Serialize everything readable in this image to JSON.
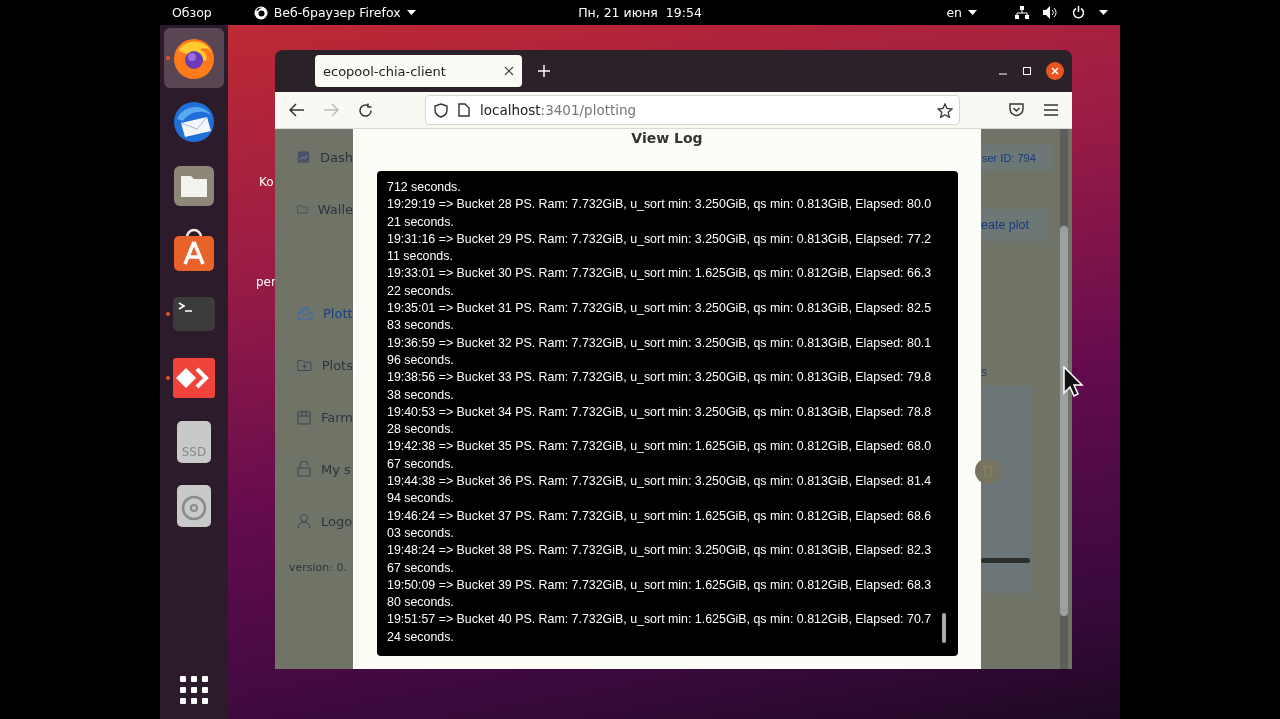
{
  "top_bar": {
    "activities": "Обзор",
    "app_menu": "Веб-браузер Firefox",
    "clock": "Пн, 21 июня  19:54",
    "keyboard_layout": "en"
  },
  "dock": {
    "items": [
      {
        "kind": "firefox",
        "running": true,
        "selected": true
      },
      {
        "kind": "mail",
        "running": false,
        "selected": false
      },
      {
        "kind": "files",
        "running": false,
        "selected": false
      },
      {
        "kind": "store",
        "running": false,
        "selected": false
      },
      {
        "kind": "terminal",
        "running": true,
        "selected": false
      },
      {
        "kind": "remote",
        "running": true,
        "selected": false
      },
      {
        "kind": "drive",
        "label": "SSD",
        "running": false,
        "selected": false
      },
      {
        "kind": "disc",
        "running": false,
        "selected": false
      }
    ]
  },
  "desktop": {
    "labels": [
      "Ko",
      "per"
    ]
  },
  "browser": {
    "tab": {
      "title": "ecopool-chia-client"
    },
    "nav": {
      "forward_disabled": true
    },
    "url": {
      "host": "localhost",
      "path": ":3401/plotting"
    }
  },
  "app": {
    "sidebar_groups": [
      [
        {
          "kind": "chart",
          "label": "Dash",
          "selected": false
        },
        {
          "kind": "wallet",
          "label": "Walle",
          "selected": false
        }
      ],
      [
        {
          "kind": "plotting",
          "label": "Plott",
          "selected": true
        },
        {
          "kind": "plots",
          "label": "Plots",
          "selected": false
        },
        {
          "kind": "farm",
          "label": "Farm",
          "selected": false
        },
        {
          "kind": "lock",
          "label": "My s",
          "selected": false
        },
        {
          "kind": "user",
          "label": "Logo",
          "selected": false
        }
      ]
    ],
    "version": "version: 0.",
    "user_button": "ser ID: 794",
    "create_button": "eate plot",
    "section_label": "s"
  },
  "log_dialog": {
    "title": "View Log",
    "lines": [
      "712 seconds.",
      "19:29:19 => Bucket 28 PS. Ram: 7.732GiB, u_sort min: 3.250GiB, qs min: 0.813GiB, Elapsed: 80.021 seconds.",
      "19:31:16 => Bucket 29 PS. Ram: 7.732GiB, u_sort min: 3.250GiB, qs min: 0.813GiB, Elapsed: 77.211 seconds.",
      "19:33:01 => Bucket 30 PS. Ram: 7.732GiB, u_sort min: 1.625GiB, qs min: 0.812GiB, Elapsed: 66.322 seconds.",
      "19:35:01 => Bucket 31 PS. Ram: 7.732GiB, u_sort min: 3.250GiB, qs min: 0.813GiB, Elapsed: 82.583 seconds.",
      "19:36:59 => Bucket 32 PS. Ram: 7.732GiB, u_sort min: 3.250GiB, qs min: 0.813GiB, Elapsed: 80.196 seconds.",
      "19:38:56 => Bucket 33 PS. Ram: 7.732GiB, u_sort min: 3.250GiB, qs min: 0.813GiB, Elapsed: 79.838 seconds.",
      "19:40:53 => Bucket 34 PS. Ram: 7.732GiB, u_sort min: 3.250GiB, qs min: 0.813GiB, Elapsed: 78.828 seconds.",
      "19:42:38 => Bucket 35 PS. Ram: 7.732GiB, u_sort min: 1.625GiB, qs min: 0.812GiB, Elapsed: 68.067 seconds.",
      "19:44:38 => Bucket 36 PS. Ram: 7.732GiB, u_sort min: 3.250GiB, qs min: 0.813GiB, Elapsed: 81.494 seconds.",
      "19:46:24 => Bucket 37 PS. Ram: 7.732GiB, u_sort min: 1.625GiB, qs min: 0.812GiB, Elapsed: 68.603 seconds.",
      "19:48:24 => Bucket 38 PS. Ram: 7.732GiB, u_sort min: 3.250GiB, qs min: 0.813GiB, Elapsed: 82.367 seconds.",
      "19:50:09 => Bucket 39 PS. Ram: 7.732GiB, u_sort min: 1.625GiB, qs min: 0.812GiB, Elapsed: 68.380 seconds.",
      "19:51:57 => Bucket 40 PS. Ram: 7.732GiB, u_sort min: 1.625GiB, qs min: 0.812GiB, Elapsed: 70.724 seconds."
    ]
  }
}
